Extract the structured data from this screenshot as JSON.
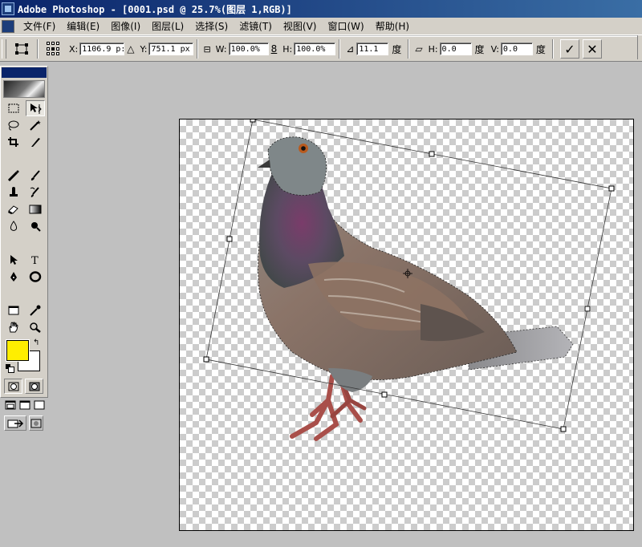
{
  "window": {
    "title": "Adobe Photoshop - [0001.psd @ 25.7%(图层 1,RGB)]"
  },
  "menu": {
    "items": [
      {
        "label": "文件(F)"
      },
      {
        "label": "编辑(E)"
      },
      {
        "label": "图像(I)"
      },
      {
        "label": "图层(L)"
      },
      {
        "label": "选择(S)"
      },
      {
        "label": "滤镜(T)"
      },
      {
        "label": "视图(V)"
      },
      {
        "label": "窗口(W)"
      },
      {
        "label": "帮助(H)"
      }
    ]
  },
  "options": {
    "x_label": "X:",
    "x_value": "1106.9 p:",
    "delta_glyph": "△",
    "y_label": "Y:",
    "y_value": "751.1 px",
    "w_label": "W:",
    "w_value": "100.0%",
    "link_glyph": "8",
    "h_label": "H:",
    "h_value": "100.0%",
    "angle_glyph": "⊿",
    "angle_value": "11.1",
    "angle_unit": "度",
    "skew_glyph": "▱",
    "skew_h_label": "H:",
    "skew_h_value": "0.0",
    "skew_h_unit": "度",
    "skew_v_label": "V:",
    "skew_v_value": "0.0",
    "skew_v_unit": "度",
    "commit_glyph": "✓",
    "cancel_glyph": "✕"
  },
  "toolbox": {
    "foreground_color": "#ffee00",
    "background_color": "#ffffff",
    "swap_glyph": "↰"
  },
  "colors": {
    "titlebar_start": "#0a246a",
    "titlebar_end": "#3a6ea5",
    "chrome": "#d4d0c8",
    "workspace": "#c0c0c0"
  }
}
